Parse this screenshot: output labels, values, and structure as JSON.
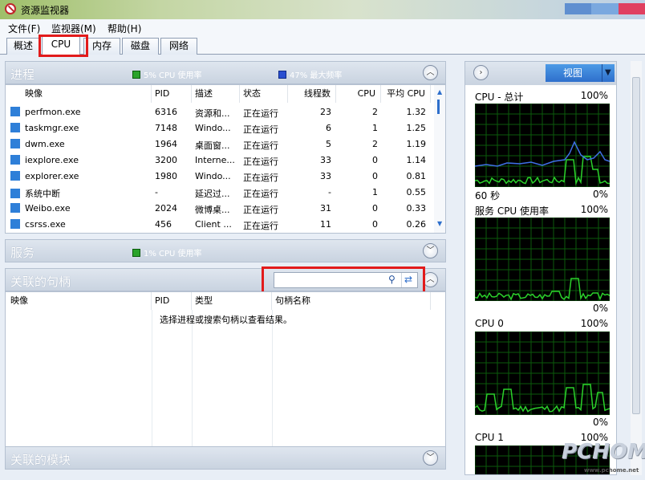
{
  "window": {
    "title": "资源监视器"
  },
  "menu": [
    {
      "label": "文件(F)"
    },
    {
      "label": "监视器(M)"
    },
    {
      "label": "帮助(H)"
    }
  ],
  "tabs": [
    {
      "label": "概述"
    },
    {
      "label": "CPU"
    },
    {
      "label": "内存"
    },
    {
      "label": "磁盘"
    },
    {
      "label": "网络"
    }
  ],
  "active_tab": "CPU",
  "colors": {
    "accent": "#2e6fcc",
    "highlight": "#e21b1b",
    "graph_green": "#2bd12b",
    "graph_blue": "#3f6fe6"
  },
  "processes": {
    "header": "进程",
    "cpu_usage": "5% CPU 使用率",
    "max_freq": "47% 最大频率",
    "columns": [
      "映像",
      "PID",
      "描述",
      "状态",
      "线程数",
      "CPU",
      "平均 CPU"
    ],
    "rows": [
      [
        "perfmon.exe",
        "6316",
        "资源和...",
        "正在运行",
        "23",
        "2",
        "1.32"
      ],
      [
        "taskmgr.exe",
        "7148",
        "Windo...",
        "正在运行",
        "6",
        "1",
        "1.25"
      ],
      [
        "dwm.exe",
        "1964",
        "桌面窗...",
        "正在运行",
        "5",
        "2",
        "1.19"
      ],
      [
        "iexplore.exe",
        "3200",
        "Interne...",
        "正在运行",
        "33",
        "0",
        "1.14"
      ],
      [
        "explorer.exe",
        "1980",
        "Windo...",
        "正在运行",
        "33",
        "0",
        "0.81"
      ],
      [
        "系统中断",
        "-",
        "延迟过...",
        "正在运行",
        "-",
        "1",
        "0.55"
      ],
      [
        "Weibo.exe",
        "2024",
        "微博桌...",
        "正在运行",
        "31",
        "0",
        "0.33"
      ],
      [
        "csrss.exe",
        "456",
        "Client ...",
        "正在运行",
        "11",
        "0",
        "0.26"
      ]
    ]
  },
  "services": {
    "header": "服务",
    "cpu_usage": "1% CPU 使用率"
  },
  "handles": {
    "header": "关联的句柄",
    "search_value": "",
    "columns": [
      "映像",
      "PID",
      "类型",
      "句柄名称"
    ],
    "empty_message": "选择进程或搜索句柄以查看结果。"
  },
  "modules": {
    "header": "关联的模块"
  },
  "right_panel": {
    "view_label": "视图",
    "graphs": [
      {
        "title": "CPU - 总计",
        "max": "100%",
        "time": "60 秒",
        "min": "0%"
      },
      {
        "title": "服务 CPU 使用率",
        "max": "100%",
        "min": "0%"
      },
      {
        "title": "CPU 0",
        "max": "100%",
        "min": "0%"
      },
      {
        "title": "CPU 1",
        "max": "100%"
      }
    ]
  },
  "watermark": {
    "text": "PCHOME",
    "sub": "www.pchome.net"
  }
}
